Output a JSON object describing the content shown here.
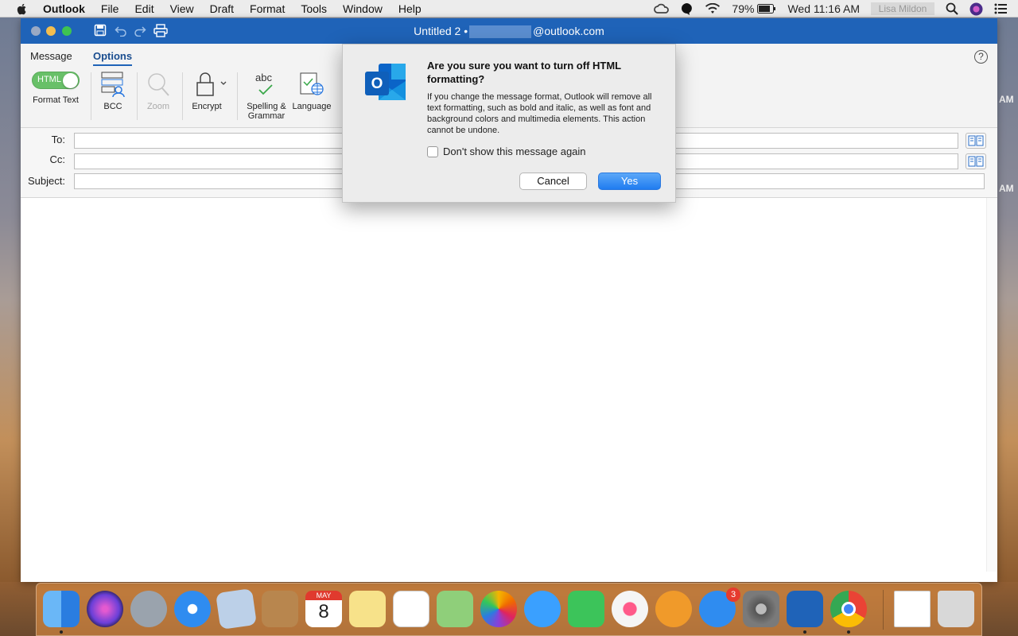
{
  "menubar": {
    "app": "Outlook",
    "items": [
      "File",
      "Edit",
      "View",
      "Draft",
      "Format",
      "Tools",
      "Window",
      "Help"
    ],
    "battery": "79%",
    "clock": "Wed 11:16 AM",
    "user": "Lisa Mildon"
  },
  "desktop": {
    "am1": "AM",
    "am2": "AM"
  },
  "window": {
    "title_prefix": "Untitled 2 •",
    "title_suffix": "@outlook.com"
  },
  "ribbon": {
    "tabs": [
      "Message",
      "Options"
    ],
    "active_tab": "Options",
    "toggle_label": "HTML",
    "format_text": "Format Text",
    "bcc": "BCC",
    "zoom": "Zoom",
    "encrypt": "Encrypt",
    "spelling": "Spelling &",
    "grammar": "Grammar",
    "language": "Language",
    "help": "?"
  },
  "headers": {
    "to": "To:",
    "cc": "Cc:",
    "subject": "Subject:"
  },
  "dialog": {
    "title": "Are you sure you want to turn off HTML formatting?",
    "text": "If you change the message format, Outlook will remove all text formatting, such as bold and italic, as well as font and background colors and multimedia elements. This action cannot be undone.",
    "checkbox": "Don't show this message again",
    "cancel": "Cancel",
    "yes": "Yes"
  },
  "dock": {
    "calendar_month": "MAY",
    "calendar_day": "8",
    "app_store_badge": "3",
    "colors": {
      "finder": "#4aa0f0",
      "siri": "#6a3fd8",
      "launchpad": "#9aa3ad",
      "safari": "#2f8cf0",
      "mail": "#bcd0e8",
      "contacts": "#b8864e",
      "calendar": "#ffffff",
      "notes": "#f7e28a",
      "reminders": "#ffffff",
      "maps": "#8fcf7a",
      "photos": "#ffffff",
      "messages": "#3aa0ff",
      "facetime": "#3cc45a",
      "itunes": "#f5f5f5",
      "books": "#f09a2a",
      "appstore": "#2f8cf0",
      "prefs": "#7a7a7a",
      "outlook": "#1f63b8",
      "chrome": "#ffffff",
      "docs": "#ffffff",
      "trash": "#d8d8d8"
    }
  }
}
